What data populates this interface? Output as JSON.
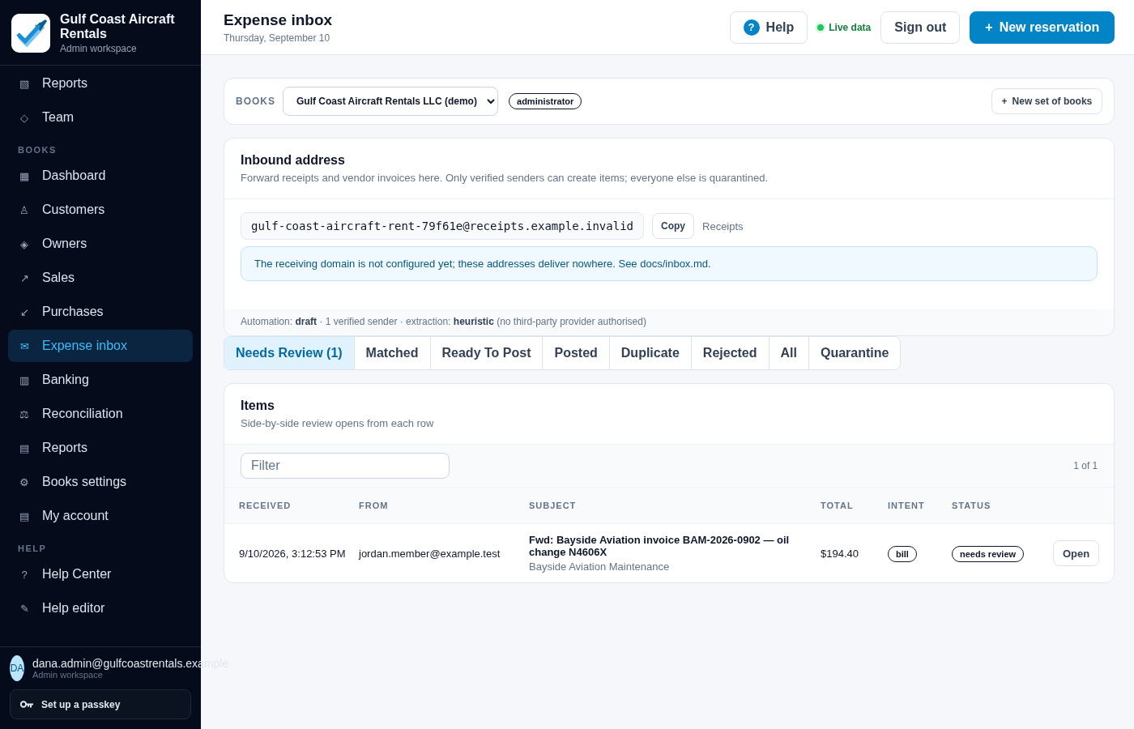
{
  "brand": {
    "name": "Gulf Coast Aircraft Rentals",
    "subtitle": "Admin workspace"
  },
  "sidebar": {
    "sections": [
      {
        "items": [
          {
            "icon": "▧",
            "label": "Reports",
            "selected": false
          },
          {
            "icon": "◇",
            "label": "Team",
            "selected": false
          }
        ]
      },
      {
        "heading": "BOOKS",
        "items": [
          {
            "icon": "▦",
            "label": "Dashboard",
            "selected": false
          },
          {
            "icon": "♙",
            "label": "Customers",
            "selected": false
          },
          {
            "icon": "◈",
            "label": "Owners",
            "selected": false
          },
          {
            "icon": "↗",
            "label": "Sales",
            "selected": false
          },
          {
            "icon": "↙",
            "label": "Purchases",
            "selected": false
          },
          {
            "icon": "✉",
            "label": "Expense inbox",
            "selected": true
          },
          {
            "icon": "▥",
            "label": "Banking",
            "selected": false
          },
          {
            "icon": "⚖",
            "label": "Reconciliation",
            "selected": false
          },
          {
            "icon": "▤",
            "label": "Reports",
            "selected": false
          },
          {
            "icon": "⚙",
            "label": "Books settings",
            "selected": false
          },
          {
            "icon": "▤",
            "label": "My account",
            "selected": false
          }
        ]
      },
      {
        "heading": "HELP",
        "items": [
          {
            "icon": "?",
            "label": "Help Center",
            "selected": false
          },
          {
            "icon": "✎",
            "label": "Help editor",
            "selected": false
          }
        ]
      }
    ],
    "user": {
      "initials": "DA",
      "email": "dana.admin@gulfcoastrentals.example",
      "workspace": "Admin workspace"
    },
    "passkey_button": "Set up a passkey"
  },
  "header": {
    "title": "Expense inbox",
    "date": "Thursday, September 10",
    "help_button": "Help",
    "help_icon": "?",
    "live_status": "Live data",
    "sign_out": "Sign out",
    "new_button": "New reservation",
    "new_icon": "+"
  },
  "books_bar": {
    "label": "BOOKS",
    "select_value": "Gulf Coast Aircraft Rentals LLC (demo)",
    "role": "administrator",
    "new_books_icon": "+",
    "new_books": "New set of books"
  },
  "inbound": {
    "title": "Inbound address",
    "description": "Forward receipts and vendor invoices here. Only verified senders can create items; everyone else is quarantined.",
    "address": "gulf-coast-aircraft-rent-79f61e@receipts.example.invalid",
    "copy_button": "Copy",
    "address_label": "Receipts",
    "notice": "The receiving domain is not configured yet; these addresses deliver nowhere. See docs/inbox.md.",
    "footer": "Automation: **draft** · 1 verified sender · extraction: **heuristic** (no third-party provider authorised)"
  },
  "tabs": [
    {
      "label": "Needs Review (1)",
      "selected": true
    },
    {
      "label": "Matched",
      "selected": false
    },
    {
      "label": "Ready To Post",
      "selected": false
    },
    {
      "label": "Posted",
      "selected": false
    },
    {
      "label": "Duplicate",
      "selected": false
    },
    {
      "label": "Rejected",
      "selected": false
    },
    {
      "label": "All",
      "selected": false
    },
    {
      "label": "Quarantine",
      "selected": false
    }
  ],
  "items": {
    "title": "Items",
    "subtitle": "Side-by-side review opens from each row",
    "filter_placeholder": "Filter",
    "count": "1 of 1",
    "columns": [
      "RECEIVED",
      "FROM",
      "SUBJECT",
      "TOTAL",
      "INTENT",
      "STATUS"
    ],
    "rows": [
      {
        "received": "9/10/2026, 3:12:53 PM",
        "from": "jordan.member@example.test",
        "subject": "Fwd: Bayside Aviation invoice BAM-2026-0902 — oil change N4606X",
        "vendor": "Bayside Aviation Maintenance",
        "total": "$194.40",
        "intent": "bill",
        "status": "needs review",
        "action": "Open"
      }
    ]
  }
}
